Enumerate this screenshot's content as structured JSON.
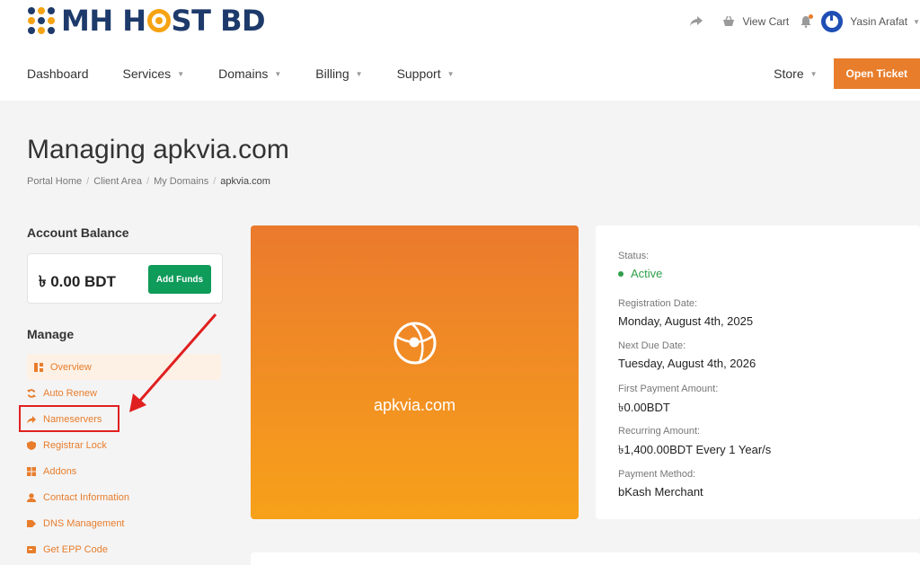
{
  "brand": {
    "name_part1": "MH H",
    "name_part2": "ST BD",
    "accent": "#f6a313",
    "primary": "#1d3a6b"
  },
  "topbar": {
    "view_cart": "View Cart",
    "user_name": "Yasin Arafat"
  },
  "nav": {
    "items": [
      {
        "label": "Dashboard",
        "has_caret": false
      },
      {
        "label": "Services",
        "has_caret": true
      },
      {
        "label": "Domains",
        "has_caret": true
      },
      {
        "label": "Billing",
        "has_caret": true
      },
      {
        "label": "Support",
        "has_caret": true
      }
    ],
    "store": "Store",
    "open_ticket": "Open Ticket",
    "caret": "▼"
  },
  "page": {
    "title": "Managing apkvia.com"
  },
  "breadcrumb": [
    "Portal Home",
    "Client Area",
    "My Domains",
    "apkvia.com"
  ],
  "breadcrumb_sep": "/",
  "sidebar": {
    "account_balance_title": "Account Balance",
    "balance": "৳ 0.00 BDT",
    "add_funds": "Add Funds",
    "manage_title": "Manage",
    "items": [
      {
        "label": "Overview",
        "icon": "dashboard-icon",
        "active": true
      },
      {
        "label": "Auto Renew",
        "icon": "refresh-icon"
      },
      {
        "label": "Nameservers",
        "icon": "arrow-right-icon"
      },
      {
        "label": "Registrar Lock",
        "icon": "shield-icon"
      },
      {
        "label": "Addons",
        "icon": "cubes-icon"
      },
      {
        "label": "Contact Information",
        "icon": "user-icon"
      },
      {
        "label": "DNS Management",
        "icon": "tag-icon"
      },
      {
        "label": "Get EPP Code",
        "icon": "code-icon"
      }
    ]
  },
  "domain_card": {
    "domain": "apkvia.com",
    "icon": "globe-icon"
  },
  "info": {
    "status_label": "Status:",
    "status_value": "Active",
    "reg_label": "Registration Date:",
    "reg_value": "Monday, August 4th, 2025",
    "due_label": "Next Due Date:",
    "due_value": "Tuesday, August 4th, 2026",
    "first_label": "First Payment Amount:",
    "first_value": "৳0.00BDT",
    "recur_label": "Recurring Amount:",
    "recur_value": "৳1,400.00BDT Every 1 Year/s",
    "method_label": "Payment Method:",
    "method_value": "bKash Merchant"
  },
  "colors": {
    "orange": "#e87d2b",
    "green": "#0f9b5a",
    "active": "#2f9e4a",
    "annotation": "#e02020"
  }
}
